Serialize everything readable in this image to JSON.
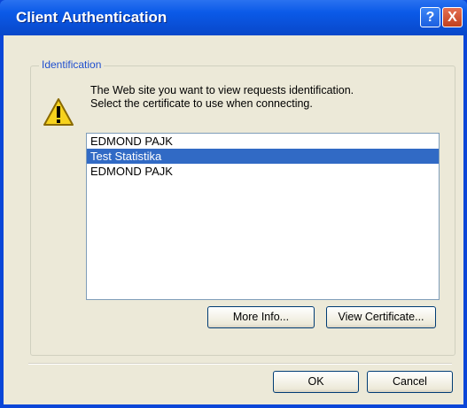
{
  "window": {
    "title": "Client Authentication",
    "help_button": "?",
    "close_button": "X"
  },
  "group": {
    "label": "Identification"
  },
  "message": {
    "line1": "The Web site you want to view requests identification.",
    "line2": "Select the certificate to use when connecting."
  },
  "certificates": {
    "items": [
      {
        "label": "EDMOND PAJK"
      },
      {
        "label": "Test Statistika"
      },
      {
        "label": "EDMOND PAJK"
      }
    ],
    "selected_index": 1
  },
  "buttons": {
    "more_info": "More Info...",
    "view_certificate": "View Certificate...",
    "ok": "OK",
    "cancel": "Cancel"
  }
}
